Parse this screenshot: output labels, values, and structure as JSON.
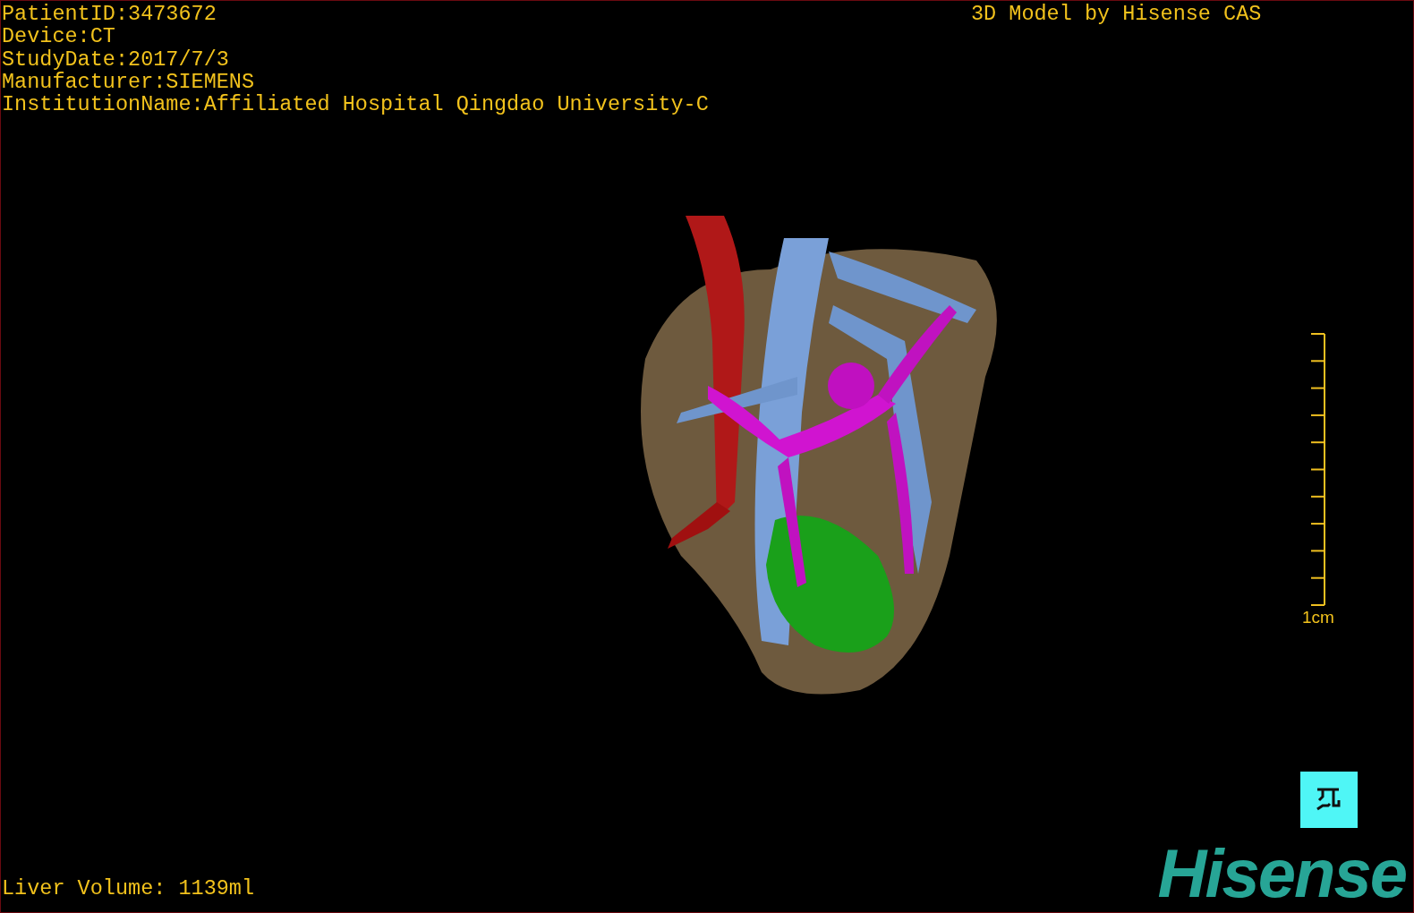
{
  "info_lines": [
    "PatientID:3473672",
    "Device:CT",
    "StudyDate:2017/7/3",
    "Manufacturer:SIEMENS",
    "InstitutionName:Affiliated Hospital Qingdao University-C"
  ],
  "credit": "3D Model by Hisense CAS",
  "scale_bar": {
    "label": "1cm"
  },
  "liver_volume": "Liver Volume: 1139ml",
  "logo": "Hisense"
}
